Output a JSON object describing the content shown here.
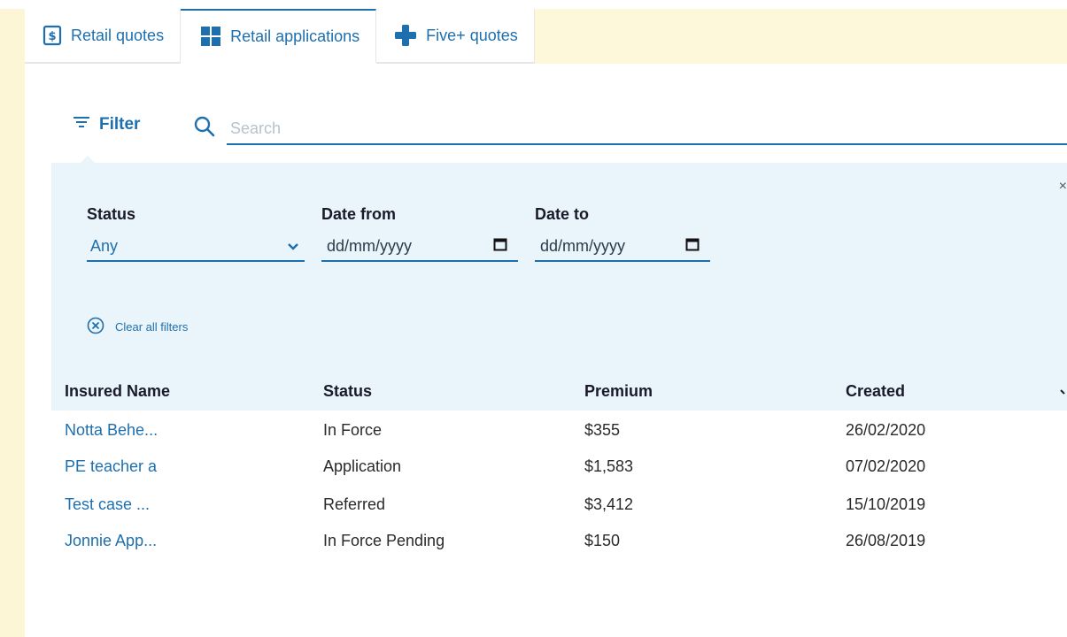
{
  "tabs": [
    {
      "label": "Retail quotes",
      "icon": "dollar-icon"
    },
    {
      "label": "Retail applications",
      "icon": "grid-icon"
    },
    {
      "label": "Five+ quotes",
      "icon": "plus-icon"
    }
  ],
  "active_tab": "Retail applications",
  "filter": {
    "label": "Filter"
  },
  "search": {
    "placeholder": "Search",
    "value": ""
  },
  "panel": {
    "close_symbol": "×",
    "status": {
      "label": "Status",
      "value": "Any"
    },
    "date_from": {
      "label": "Date from",
      "placeholder": "dd/mm/yyyy"
    },
    "date_to": {
      "label": "Date to",
      "placeholder": "dd/mm/yyyy"
    },
    "clear_label": "Clear all filters"
  },
  "table": {
    "columns": [
      "Insured Name",
      "Status",
      "Premium",
      "Created"
    ],
    "rows": [
      {
        "name": "Notta Behe...",
        "status": "In Force",
        "premium": "$355",
        "created": "26/02/2020"
      },
      {
        "name": "PE teacher a",
        "status": "Application",
        "premium": "$1,583",
        "created": "07/02/2020"
      },
      {
        "name": "Test case ...",
        "status": "Referred",
        "premium": "$3,412",
        "created": "15/10/2019"
      },
      {
        "name": "Jonnie App...",
        "status": "In Force Pending",
        "premium": "$150",
        "created": "26/08/2019"
      }
    ]
  },
  "colors": {
    "accent": "#1e6fae",
    "panel_bg": "#eaf4fb",
    "page_bg": "#fdf6d6"
  }
}
